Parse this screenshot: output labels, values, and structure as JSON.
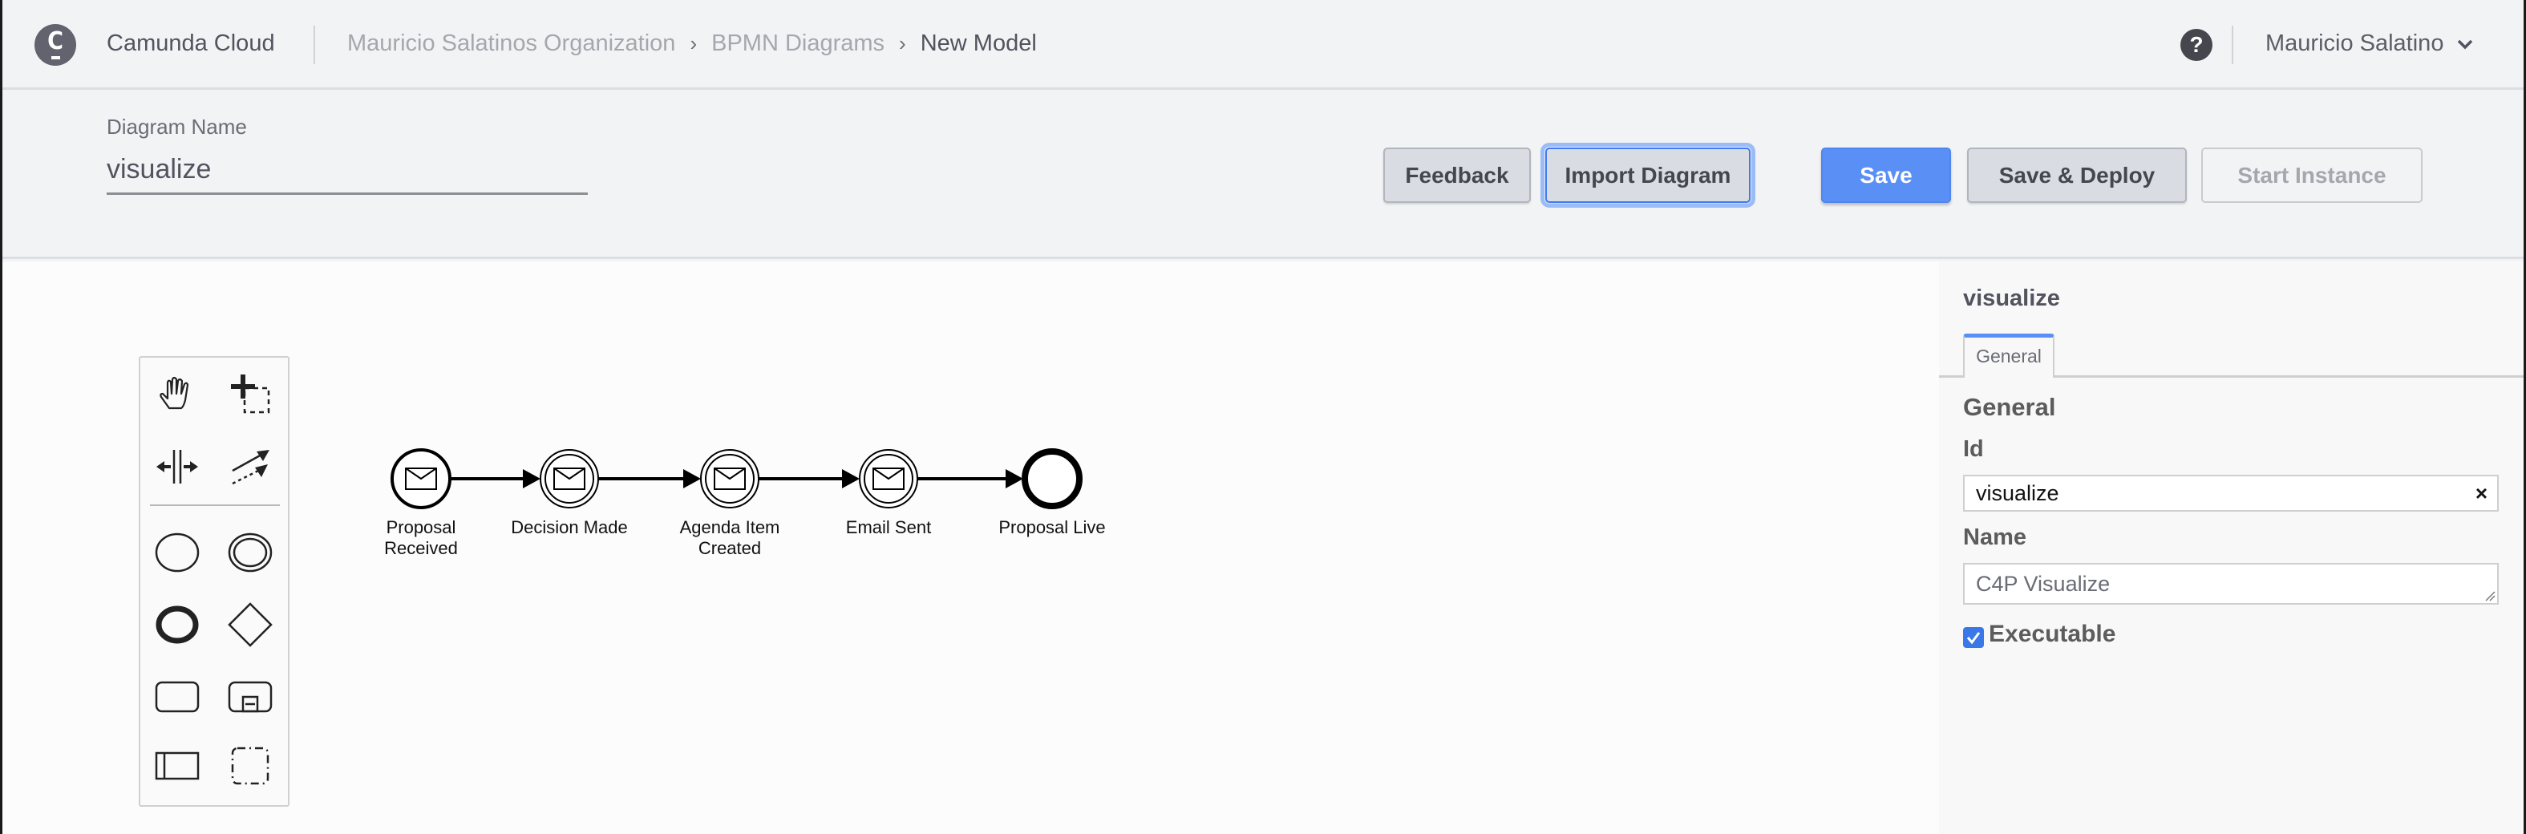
{
  "nav": {
    "brand": "Camunda Cloud",
    "breadcrumbs": [
      "Mauricio Salatinos Organization",
      "BPMN Diagrams"
    ],
    "breadcrumb_separator": "›",
    "current": "New Model",
    "help_icon": "?",
    "user_name": "Mauricio Salatino"
  },
  "toolbar": {
    "diagram_name_label": "Diagram Name",
    "diagram_name_value": "visualize",
    "buttons": {
      "feedback": "Feedback",
      "import": "Import Diagram",
      "save": "Save",
      "save_deploy": "Save & Deploy",
      "start_instance": "Start Instance"
    }
  },
  "palette": {
    "tools": [
      "hand-tool",
      "lasso-tool",
      "space-tool",
      "global-connect-tool",
      "create-start-event",
      "create-intermediate-event",
      "create-end-event",
      "create-gateway",
      "create-task",
      "create-subprocess",
      "create-pool",
      "create-group"
    ]
  },
  "diagram": {
    "events": [
      {
        "type": "message-start-event",
        "label": [
          "Proposal",
          "Received"
        ]
      },
      {
        "type": "message-intermediate-catch-event",
        "label": [
          "Decision Made"
        ]
      },
      {
        "type": "message-intermediate-catch-event",
        "label": [
          "Agenda Item",
          "Created"
        ]
      },
      {
        "type": "message-intermediate-catch-event",
        "label": [
          "Email Sent"
        ]
      },
      {
        "type": "end-event",
        "label": [
          "Proposal Live"
        ]
      }
    ]
  },
  "properties": {
    "title": "visualize",
    "tab": "General",
    "group": "General",
    "id_label": "Id",
    "id_value": "visualize",
    "clear_icon": "×",
    "name_label": "Name",
    "name_value": "C4P Visualize",
    "executable_label": "Executable",
    "executable_checked": true
  },
  "colors": {
    "primary": "#5a90f5",
    "focus_ring": "#9bbcf7"
  }
}
